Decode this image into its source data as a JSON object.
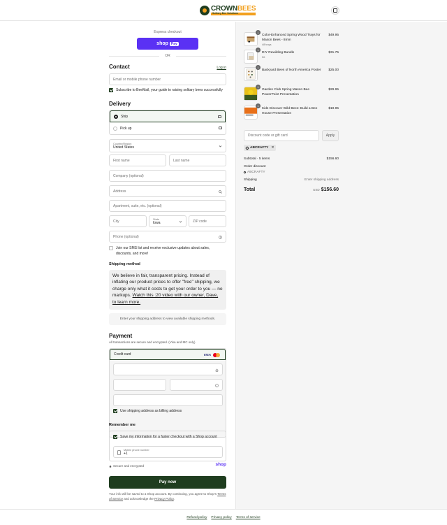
{
  "brand": {
    "name_part1": "CROWN",
    "name_part2": "BEES",
    "tagline": "Solitary Bee Solutions"
  },
  "express": {
    "label": "Express checkout",
    "shop_pay_label": "shop",
    "shop_pay_pill": "Pay",
    "or_label": "OR"
  },
  "contact": {
    "heading": "Contact",
    "login_link": "Log in",
    "email_placeholder": "Email or mobile phone number",
    "subscribe_label": "Subscribe to BeeMail, your guide to raising solitary bees successfully"
  },
  "delivery": {
    "heading": "Delivery",
    "options": [
      {
        "label": "Ship",
        "selected": true
      },
      {
        "label": "Pick up",
        "selected": false
      }
    ],
    "country_label": "Country/Region",
    "country_value": "United States",
    "first_name": "First name",
    "last_name": "Last name",
    "company": "Company (optional)",
    "address": "Address",
    "apartment": "Apartment, suite, etc. (optional)",
    "city": "City",
    "state_label": "State",
    "state_value": "Iowa",
    "zip": "ZIP code",
    "phone": "Phone (optional)",
    "sms_label": "Join our SMS list and receive exclusive updates about sales, discounts, and more!"
  },
  "shipping_method": {
    "heading": "Shipping method",
    "message_part1": "We believe in fair, transparent pricing. Instead of inflating our product prices to offer \"free\" shipping, we charge only what it costs to get your order to you — no markups.",
    "message_link": "Watch this :20 video with our owner, Dave, to learn more.",
    "info": "Enter your shipping address to view available shipping methods."
  },
  "payment": {
    "heading": "Payment",
    "subheading": "All transactions are secure and encrypted. (Visa and MC only)",
    "method_label": "Credit card",
    "visa_label": "VISA",
    "billing_label": "Use shipping address as billing address"
  },
  "remember": {
    "heading": "Remember me",
    "save_label": "Save my information for a faster checkout with a Shop account",
    "mobile_label": "Mobile phone number",
    "mobile_value": "+1",
    "secure_label": "Secure and encrypted",
    "shop_label": "shop"
  },
  "pay_button": "Pay now",
  "fine_print": {
    "text1": "Your info will be saved to a Shop account. By continuing, you agree to Shop's",
    "terms": "Terms of Service",
    "text2": "and acknowledge the",
    "privacy": "Privacy Policy",
    "end": "."
  },
  "cart": {
    "items": [
      {
        "qty": "1",
        "name": "Color-Enhanced Spring Wood Trays for Mason Bees - 8mm",
        "variant": "48 trays",
        "price": "$49.95"
      },
      {
        "qty": "1",
        "name": "DIY Rewilding Bundle",
        "variant": "Kit",
        "price": "$31.75"
      },
      {
        "qty": "1",
        "name": "Backyard Bees of North America Poster",
        "variant": "",
        "price": "$25.00"
      },
      {
        "qty": "1",
        "name": "Garden Club Spring Mason Bee PowerPoint Presentation",
        "variant": "",
        "price": "$29.95"
      },
      {
        "qty": "1",
        "name": "Kids Discover Wild Bees: Build a Bee House Presentation",
        "variant": "",
        "price": "$19.95"
      }
    ],
    "discount_placeholder": "Discount code or gift card",
    "apply_label": "Apply",
    "applied_code": "ABCRAFTY",
    "subtotal_label": "Subtotal · 5 items",
    "subtotal_value": "$156.60",
    "order_discount_label": "Order discount",
    "order_discount_code": "ABCRAFTY",
    "shipping_label": "Shipping",
    "shipping_value": "Enter shipping address",
    "total_label": "Total",
    "currency": "USD",
    "total_value": "$156.60"
  },
  "footer": {
    "links": [
      "Refund policy",
      "Privacy policy",
      "Terms of service"
    ]
  },
  "colors": {
    "brand_green": "#1f3d1f",
    "brand_orange": "#f2a01e",
    "shop_pay_purple": "#5a31f4"
  }
}
